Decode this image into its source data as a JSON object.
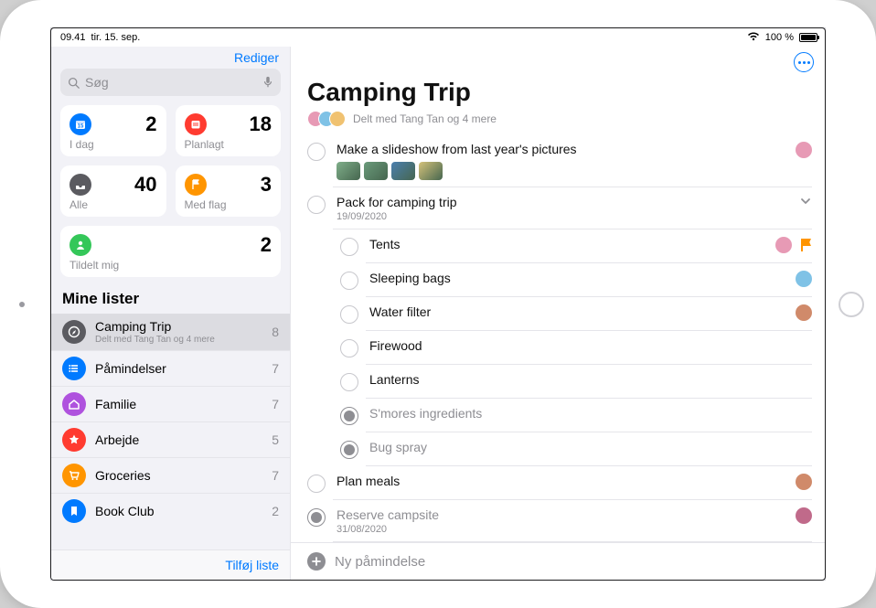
{
  "status": {
    "time": "09.41",
    "date": "tir. 15. sep.",
    "battery_pct": "100 %"
  },
  "sidebar": {
    "edit_label": "Rediger",
    "search_placeholder": "Søg",
    "smart_lists": {
      "today": {
        "label": "I dag",
        "count": "2"
      },
      "scheduled": {
        "label": "Planlagt",
        "count": "18"
      },
      "all": {
        "label": "Alle",
        "count": "40"
      },
      "flagged": {
        "label": "Med flag",
        "count": "3"
      },
      "assigned": {
        "label": "Tildelt mig",
        "count": "2"
      }
    },
    "section_title": "Mine lister",
    "lists": [
      {
        "name": "Camping Trip",
        "subtitle": "Delt med Tang Tan og 4 mere",
        "count": "8",
        "color": "#5b5b60",
        "icon": "compass"
      },
      {
        "name": "Påmindelser",
        "subtitle": "",
        "count": "7",
        "color": "#007aff",
        "icon": "list"
      },
      {
        "name": "Familie",
        "subtitle": "",
        "count": "7",
        "color": "#af52de",
        "icon": "home"
      },
      {
        "name": "Arbejde",
        "subtitle": "",
        "count": "5",
        "color": "#ff3b30",
        "icon": "star"
      },
      {
        "name": "Groceries",
        "subtitle": "",
        "count": "7",
        "color": "#ff9500",
        "icon": "cart"
      },
      {
        "name": "Book Club",
        "subtitle": "",
        "count": "2",
        "color": "#007aff",
        "icon": "bookmark"
      }
    ],
    "add_list_label": "Tilføj liste"
  },
  "main": {
    "title": "Camping Trip",
    "shared_text": "Delt med Tang Tan og 4 mere",
    "avatar_colors": [
      "#e79ab5",
      "#7fc2e6",
      "#f0c271"
    ],
    "reminders": [
      {
        "title": "Make a slideshow from last year's pictures",
        "done": false,
        "avatar": "#e79ab5",
        "thumbs": [
          "#7fae89",
          "#6a9a7a",
          "#4b7fae",
          "#d4c27a"
        ]
      },
      {
        "title": "Pack for camping trip",
        "done": false,
        "date": "19/09/2020",
        "expandable": true,
        "subtasks": [
          {
            "title": "Tents",
            "done": false,
            "avatar": "#e79ab5",
            "flagged": true
          },
          {
            "title": "Sleeping bags",
            "done": false,
            "avatar": "#7fc2e6"
          },
          {
            "title": "Water filter",
            "done": false,
            "avatar": "#d08a6a"
          },
          {
            "title": "Firewood",
            "done": false
          },
          {
            "title": "Lanterns",
            "done": false
          },
          {
            "title": "S'mores ingredients",
            "done": true
          },
          {
            "title": "Bug spray",
            "done": true
          }
        ]
      },
      {
        "title": "Plan meals",
        "done": false,
        "avatar": "#d08a6a"
      },
      {
        "title": "Reserve campsite",
        "done": true,
        "date": "31/08/2020",
        "avatar": "#c06a8a"
      }
    ],
    "new_reminder_label": "Ny påmindelse"
  }
}
